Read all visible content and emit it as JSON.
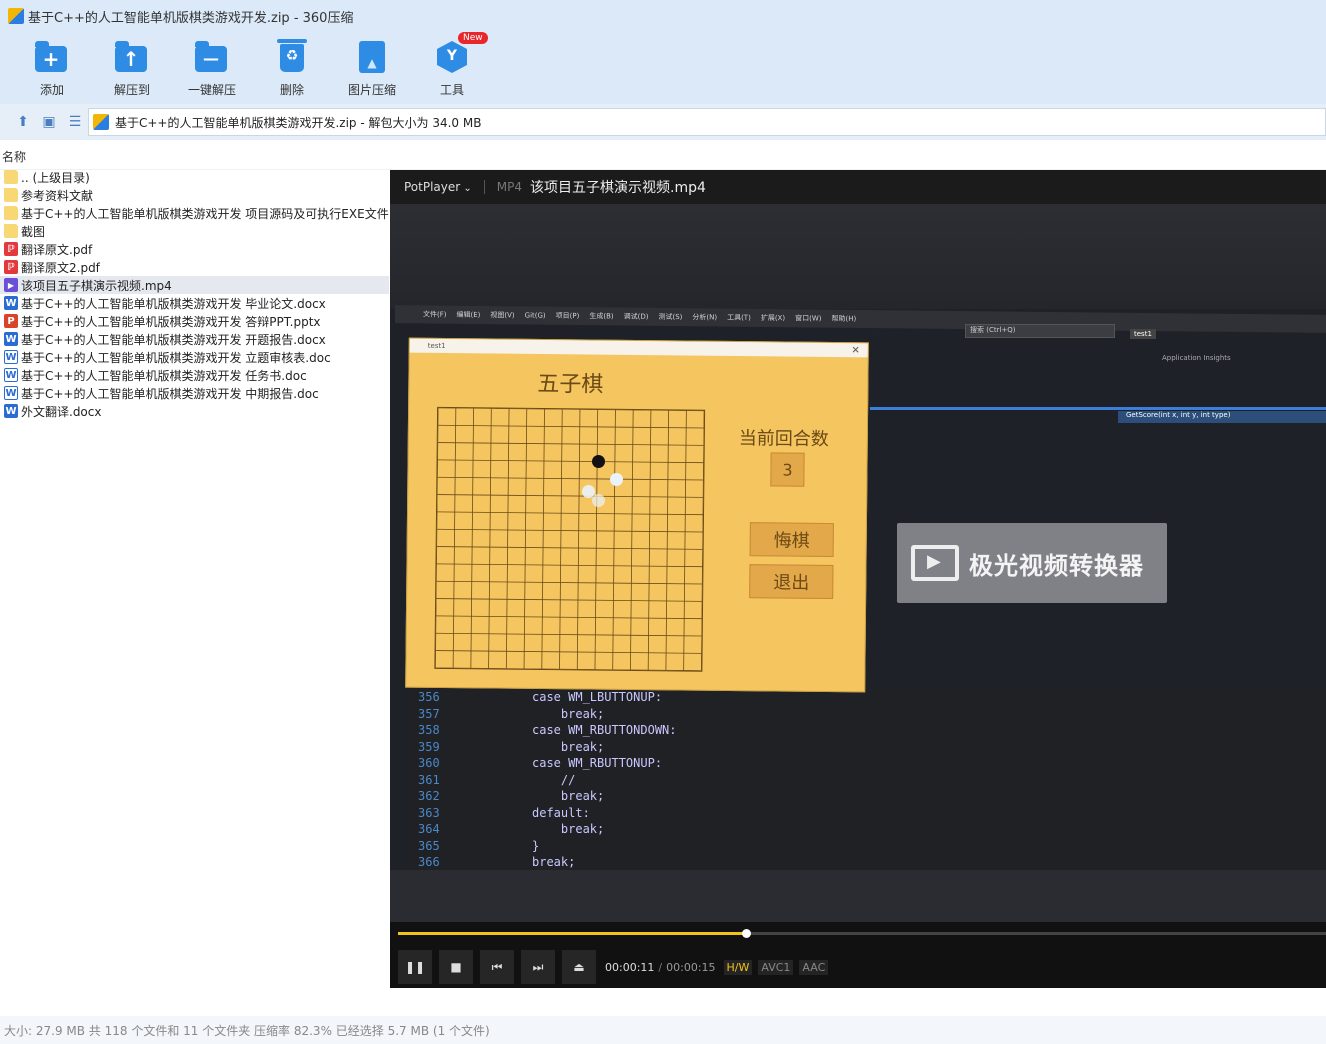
{
  "window": {
    "title": "基于C++的人工智能单机版棋类游戏开发.zip - 360压缩"
  },
  "toolbar": {
    "items": [
      {
        "label": "添加",
        "icon": "folder-add-icon"
      },
      {
        "label": "解压到",
        "icon": "extract-to-icon"
      },
      {
        "label": "一键解压",
        "icon": "one-click-extract-icon"
      },
      {
        "label": "删除",
        "icon": "trash-icon"
      },
      {
        "label": "图片压缩",
        "icon": "image-compress-icon"
      },
      {
        "label": "工具",
        "icon": "tools-icon",
        "badge": "New"
      }
    ]
  },
  "address": {
    "path": "基于C++的人工智能单机版棋类游戏开发.zip - 解包大小为 34.0 MB"
  },
  "filelist": {
    "column_name": "名称",
    "rows": [
      {
        "label": ".. (上级目录)",
        "type": "folder"
      },
      {
        "label": "参考资料文献",
        "type": "folder"
      },
      {
        "label": "基于C++的人工智能单机版棋类游戏开发 项目源码及可执行EXE文件",
        "type": "folder"
      },
      {
        "label": "截图",
        "type": "folder"
      },
      {
        "label": "翻译原文.pdf",
        "type": "pdf"
      },
      {
        "label": "翻译原文2.pdf",
        "type": "pdf"
      },
      {
        "label": "该项目五子棋演示视频.mp4",
        "type": "mp4",
        "selected": true
      },
      {
        "label": "基于C++的人工智能单机版棋类游戏开发 毕业论文.docx",
        "type": "word"
      },
      {
        "label": "基于C++的人工智能单机版棋类游戏开发 答辩PPT.pptx",
        "type": "ppt"
      },
      {
        "label": "基于C++的人工智能单机版棋类游戏开发 开题报告.docx",
        "type": "word"
      },
      {
        "label": "基于C++的人工智能单机版棋类游戏开发 立题审核表.doc",
        "type": "word"
      },
      {
        "label": "基于C++的人工智能单机版棋类游戏开发 任务书.doc",
        "type": "word"
      },
      {
        "label": "基于C++的人工智能单机版棋类游戏开发 中期报告.doc",
        "type": "word"
      },
      {
        "label": "外文翻译.docx",
        "type": "word"
      }
    ]
  },
  "status": {
    "text": "大小: 27.9 MB 共 118 个文件和 11 个文件夹 压缩率 82.3% 已经选择 5.7 MB (1 个文件)"
  },
  "player": {
    "brand": "PotPlayer",
    "format": "MP4",
    "filename": "该项目五子棋演示视频.mp4",
    "time_current": "00:00:11",
    "time_sep": "/",
    "time_total": "00:00:15",
    "progress": 0.3747,
    "tag_hw": "H/W",
    "tag_video": "AVC1",
    "tag_audio": "AAC",
    "accent_color": "#f2c31a"
  },
  "video": {
    "ide_menu": [
      "文件(F)",
      "编辑(E)",
      "视图(V)",
      "Git(G)",
      "项目(P)",
      "生成(B)",
      "调试(D)",
      "测试(S)",
      "分析(N)",
      "工具(T)",
      "扩展(X)",
      "窗口(W)",
      "帮助(H)"
    ],
    "ide_search": "搜索 (Ctrl+Q)",
    "ide_project": "test1",
    "ide_insights": "Application Insights",
    "ide_function": "GetScore(int x, int y, int type)",
    "code_lines": [
      {
        "num": "356",
        "text": "case WM_LBUTTONUP:"
      },
      {
        "num": "357",
        "text": "    break;"
      },
      {
        "num": "358",
        "text": "case WM_RBUTTONDOWN:"
      },
      {
        "num": "359",
        "text": "    break;"
      },
      {
        "num": "360",
        "text": "case WM_RBUTTONUP:"
      },
      {
        "num": "361",
        "text": "    //"
      },
      {
        "num": "362",
        "text": "    break;"
      },
      {
        "num": "363",
        "text": "default:"
      },
      {
        "num": "364",
        "text": "    break;"
      },
      {
        "num": "365",
        "text": "}"
      },
      {
        "num": "366",
        "text": "break;"
      }
    ],
    "game": {
      "window_title": "test1",
      "heading": "五子棋",
      "round_label": "当前回合数",
      "round_value": "3",
      "undo_button": "悔棋",
      "exit_button": "退出"
    },
    "watermark": "极光视频转换器"
  }
}
